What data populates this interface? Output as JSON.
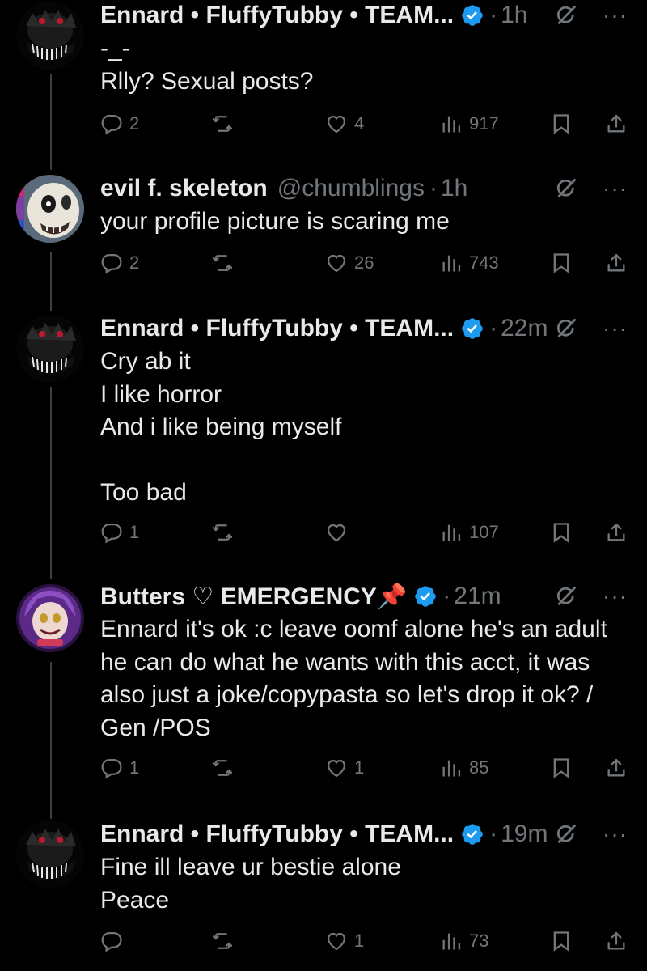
{
  "tweets": [
    {
      "name": "Ennard • FluffyTubby • TEAM...",
      "handle": "",
      "time": "1h",
      "verified": true,
      "body": "-_-\nRlly? Sexual posts?",
      "replies": "2",
      "reposts": "",
      "likes": "4",
      "views": "917"
    },
    {
      "name": "evil f. skeleton",
      "handle": "@chumblings",
      "time": "1h",
      "verified": false,
      "body": "your profile picture is scaring me",
      "replies": "2",
      "reposts": "",
      "likes": "26",
      "views": "743"
    },
    {
      "name": "Ennard • FluffyTubby • TEAM...",
      "handle": "",
      "time": "22m",
      "verified": true,
      "body": "Cry ab it\nI like horror\nAnd i like being myself\n\nToo bad",
      "replies": "1",
      "reposts": "",
      "likes": "",
      "views": "107"
    },
    {
      "name": "Butters ♡ EMERGENCY📌",
      "handle": "",
      "time": "21m",
      "verified": true,
      "body": "Ennard it's ok :c leave oomf alone he's an adult\nhe can do what he wants with this acct, it was\nalso just a joke/copypasta so let's drop it ok? /\nGen /POS",
      "replies": "1",
      "reposts": "",
      "likes": "1",
      "views": "85"
    },
    {
      "name": "Ennard • FluffyTubby • TEAM...",
      "handle": "",
      "time": "19m",
      "verified": true,
      "body": "Fine ill leave ur bestie alone\nPeace",
      "replies": "",
      "reposts": "",
      "likes": "1",
      "views": "73"
    }
  ],
  "colors": {
    "background": "#000000",
    "text": "#e7e9ea",
    "muted": "#71767b",
    "verified": "#1d9bf0",
    "thread_line": "#3e4144"
  },
  "icons": [
    "reply-icon",
    "repost-icon",
    "like-icon",
    "views-icon",
    "bookmark-icon",
    "share-icon",
    "grok-icon",
    "more-icon",
    "verified-badge-icon"
  ]
}
